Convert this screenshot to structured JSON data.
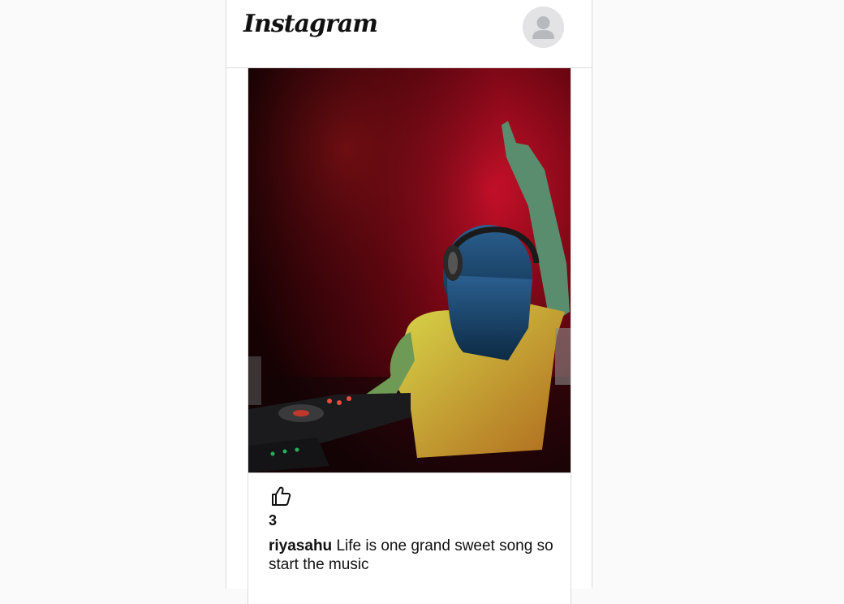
{
  "header": {
    "logo_text": "Instagram",
    "avatar_icon": "default-user-avatar-icon"
  },
  "post": {
    "image_description_icon": "dj-photo",
    "like_icon": "thumbs-up-icon",
    "likes_count": "3",
    "username": "riyasahu",
    "caption": "Life is one grand sweet song so start the music"
  },
  "colors": {
    "background": "#fafafa",
    "border": "#dbdbdb",
    "text": "#111111"
  }
}
